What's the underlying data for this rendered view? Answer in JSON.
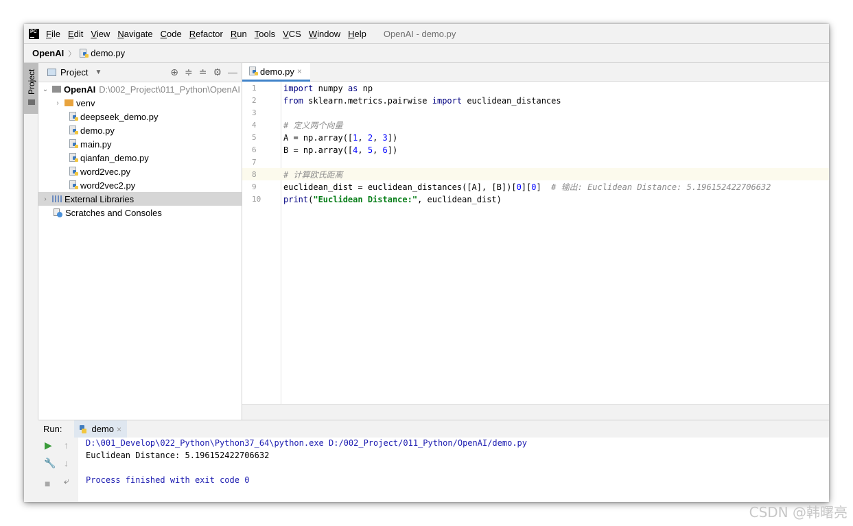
{
  "menubar": {
    "app_logo": "PC",
    "items": [
      "File",
      "Edit",
      "View",
      "Navigate",
      "Code",
      "Refactor",
      "Run",
      "Tools",
      "VCS",
      "Window",
      "Help"
    ],
    "window_title": "OpenAI - demo.py"
  },
  "breadcrumb": {
    "root": "OpenAI",
    "file": "demo.py"
  },
  "left_strip": {
    "tab_label": "Project"
  },
  "project_panel": {
    "title": "Project",
    "root_name": "OpenAI",
    "root_path": "D:\\002_Project\\011_Python\\OpenAI",
    "venv": "venv",
    "files": [
      "deepseek_demo.py",
      "demo.py",
      "main.py",
      "qianfan_demo.py",
      "word2vec.py",
      "word2vec2.py"
    ],
    "external_libraries": "External Libraries",
    "scratches": "Scratches and Consoles"
  },
  "editor": {
    "tab_label": "demo.py",
    "line_numbers": [
      "1",
      "2",
      "3",
      "4",
      "5",
      "6",
      "7",
      "8",
      "9",
      "10"
    ]
  },
  "code": {
    "l1": [
      "import",
      " numpy ",
      "as",
      " np"
    ],
    "l2": [
      "from",
      " sklearn.metrics.pairwise ",
      "import",
      " euclidean_distances"
    ],
    "l4": "# 定义两个向量",
    "l5": [
      "A = np.array([",
      "1",
      ", ",
      "2",
      ", ",
      "3",
      "])"
    ],
    "l6": [
      "B = np.array([",
      "4",
      ", ",
      "5",
      ", ",
      "6",
      "])"
    ],
    "l8": "# 计算欧氏距离",
    "l9": [
      "euclidean_dist = euclidean_distances([A], [B])[",
      "0",
      "][",
      "0",
      "]  ",
      "# 输出: Euclidean Distance: 5.196152422706632"
    ],
    "l10": [
      "print",
      "(",
      "\"Euclidean Distance:\"",
      ", euclidean_dist)"
    ]
  },
  "run_panel": {
    "label": "Run:",
    "tab": "demo",
    "console": [
      "D:\\001_Develop\\022_Python\\Python37_64\\python.exe D:/002_Project/011_Python/OpenAI/demo.py",
      "Euclidean Distance: 5.196152422706632",
      "",
      "Process finished with exit code 0"
    ]
  },
  "watermark": "CSDN @韩曙亮"
}
